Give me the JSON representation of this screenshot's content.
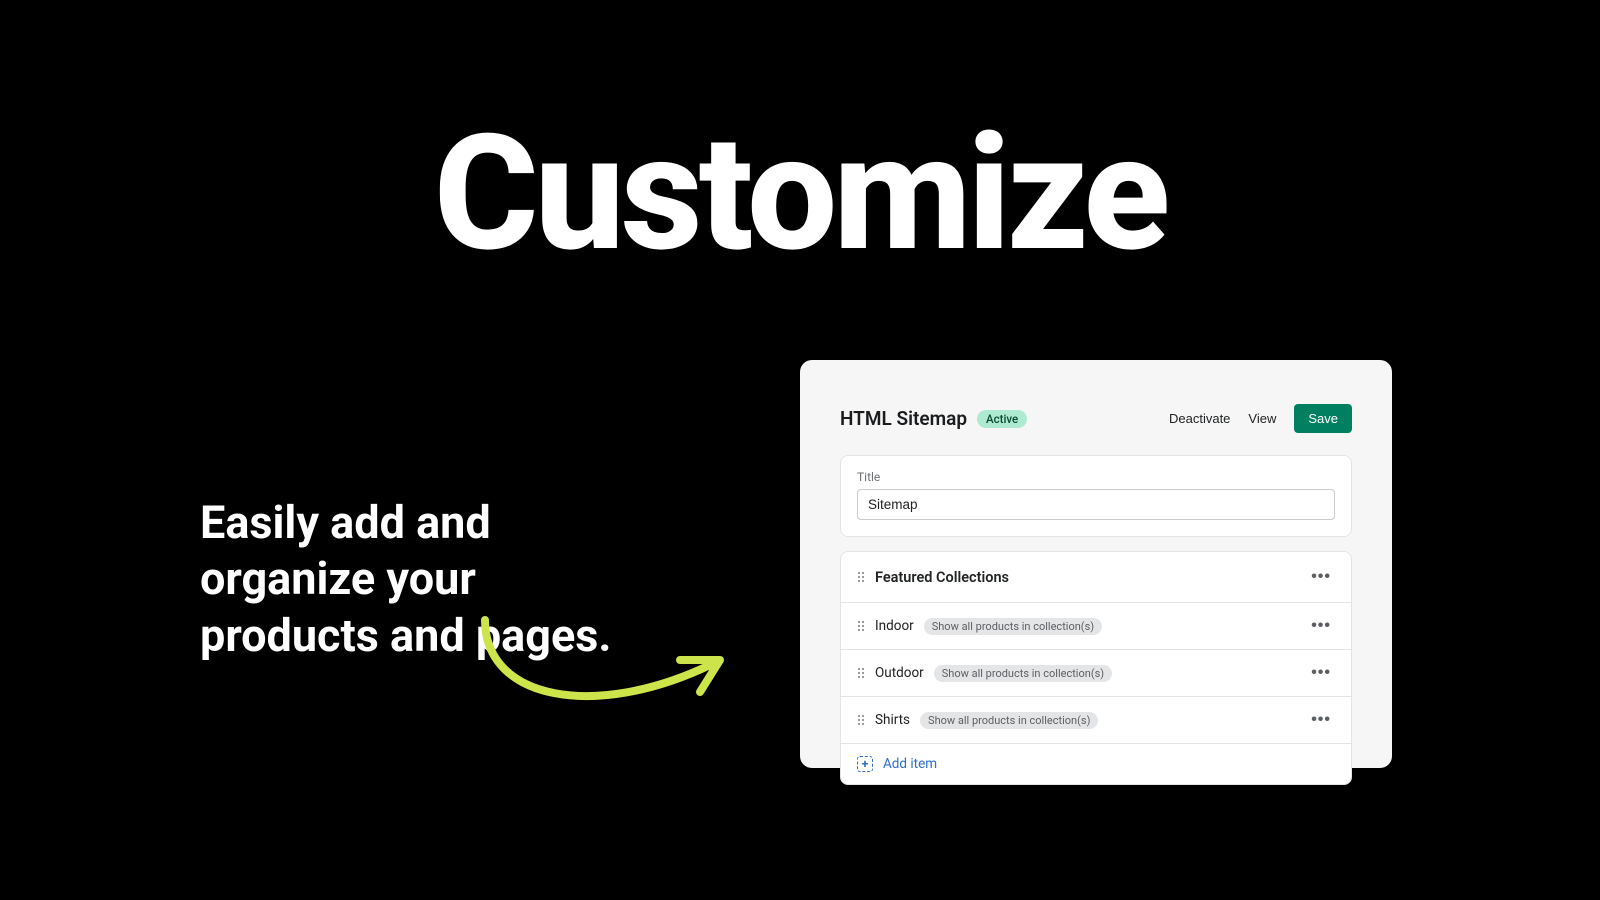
{
  "hero": {
    "title": "Customize",
    "subtitle": "Easily add and organize your products and pages."
  },
  "panel": {
    "pageTitle": "HTML Sitemap",
    "statusBadge": "Active",
    "actions": {
      "deactivate": "Deactivate",
      "view": "View",
      "save": "Save"
    },
    "titleField": {
      "label": "Title",
      "value": "Sitemap"
    },
    "sectionTitle": "Featured Collections",
    "rows": [
      {
        "name": "Indoor",
        "tag": "Show all products in collection(s)"
      },
      {
        "name": "Outdoor",
        "tag": "Show all products in collection(s)"
      },
      {
        "name": "Shirts",
        "tag": "Show all products in collection(s)"
      }
    ],
    "addItemLabel": "Add item"
  },
  "colors": {
    "accentGreen": "#008060",
    "badgeGreen": "#aee9d1",
    "link": "#2c6ecb",
    "arrow": "#cde44a"
  }
}
